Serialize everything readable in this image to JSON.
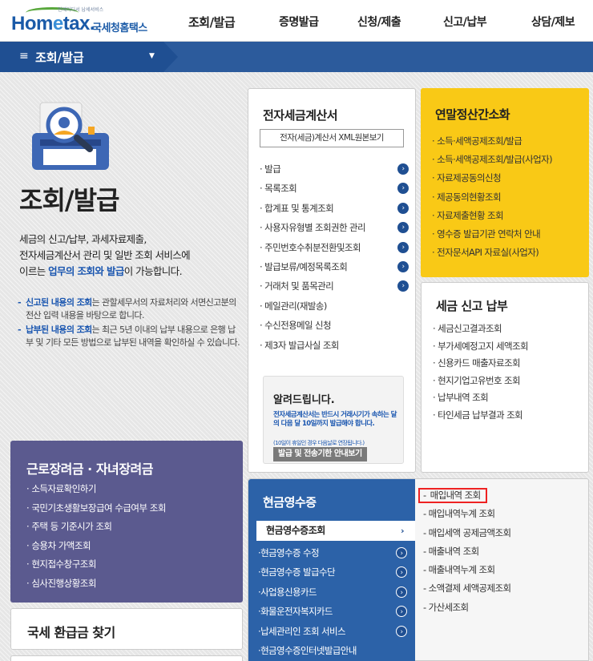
{
  "header": {
    "logo_tagline": "언제어디서 납세서비스",
    "logo_main": "Hometax",
    "logo_main_pre": "Hom",
    "logo_main_e": "e",
    "logo_main_post": "tax.",
    "logo_sub": "국세청홈택스",
    "nav": [
      "조회/발급",
      "증명발급",
      "신청/제출",
      "신고/납부",
      "상담/제보"
    ]
  },
  "subnav": {
    "menu_label": "조회/발급"
  },
  "hero": {
    "title": "조회/발급",
    "desc_1": "세금의 신고/납부, 과세자료제출,",
    "desc_2": "전자세금계산서 관리 및 일반 조회 서비스에",
    "desc_3_pre": "이르는 ",
    "desc_3_hl": "업무의 조회와 발급",
    "desc_3_post": "이 가능합니다.",
    "note1_hl": "신고된 내용의 조회",
    "note1_rest": "는 관할세무서의 자료처리와 서면신고분의 전산 입력 내용을 바탕으로 합니다.",
    "note2_hl": "납부된 내용의 조회",
    "note2_rest": "는 최근 5년 이내의 납부 내용으로 은행 납부 및 기타 모든 방법으로 납부된 내역을 확인하실 수 있습니다."
  },
  "etax": {
    "title": "전자세금계산서",
    "xml_button": "전자(세금)계산서 XML원본보기",
    "items": [
      {
        "label": "발급",
        "arrow": true
      },
      {
        "label": "목록조회",
        "arrow": true
      },
      {
        "label": "합계표 및 통계조회",
        "arrow": true
      },
      {
        "label": "사용자유형별 조회권한 관리",
        "arrow": true
      },
      {
        "label": "주민번호수취분전환및조회",
        "arrow": true
      },
      {
        "label": "발급보류/예정목록조회",
        "arrow": true
      },
      {
        "label": "거래처 및 품목관리",
        "arrow": true
      },
      {
        "label": "메일관리(재발송)",
        "arrow": false
      },
      {
        "label": "수신전용메일 신청",
        "arrow": false
      },
      {
        "label": "제3자 발급사실 조회",
        "arrow": false
      }
    ],
    "notice_title": "알려드립니다.",
    "notice_body": "전자세금계산서는 반드시 거래시기가 속하는 달의 다음 달 10일까지 발급해야 합니다.",
    "notice_small": "(10일이 휴일인 경우 다음날로 연장됩니다.)",
    "notice_button": "발급 및 전송기한 안내보기"
  },
  "yearend": {
    "title": "연말정산간소화",
    "items": [
      "소득·세액공제조회/발급",
      "소득·세액공제조회/발급(사업자)",
      "자료제공동의신청",
      "제공동의현황조회",
      "자료제출현황 조회",
      "영수증 발급기관 연락처 안내",
      "전자문서API 자료실(사업자)"
    ]
  },
  "taxreport": {
    "title": "세금 신고 납부",
    "items": [
      "세금신고결과조회",
      "부가세예정고지 세액조회",
      "신용카드 매출자료조회",
      "현지기업고유번호 조회",
      "납부내역 조회",
      "타인세금 납부결과 조회"
    ]
  },
  "labor": {
    "title": "근로장려금 · 자녀장려금",
    "items": [
      "소득자료확인하기",
      "국민기초생활보장급여 수급여부 조회",
      "주택 등 기준시가 조회",
      "승용차 가액조회",
      "현지접수창구조회",
      "심사진행상황조회"
    ]
  },
  "refund": {
    "title": "국세 환급금 찾기"
  },
  "cash": {
    "title": "현금영수증",
    "selected": "현금영수증조회",
    "left_items": [
      {
        "label": "현금영수증 수정",
        "arrow": true
      },
      {
        "label": "현금영수증 발급수단",
        "arrow": true
      },
      {
        "label": "사업용신용카드",
        "arrow": true
      },
      {
        "label": "화물운전자복지카드",
        "arrow": true
      },
      {
        "label": "납세관리인 조회 서비스",
        "arrow": true
      },
      {
        "label": "현금영수증인터넷발급안내",
        "arrow": false
      }
    ],
    "right_items": [
      "매입내역 조회",
      "매입내역누계 조회",
      "매입세액 공제금액조회",
      "매출내역 조회",
      "매출내역누계 조회",
      "소액결제 세액공제조회",
      "가산세조회"
    ],
    "active_index": 0
  },
  "colors": {
    "brand": "#1a5aa8",
    "navbar": "#2c5b9c",
    "yellow": "#f9c916",
    "purple": "#5b5a8f",
    "cash": "#2c62a8",
    "highlight_border": "#e22222"
  }
}
